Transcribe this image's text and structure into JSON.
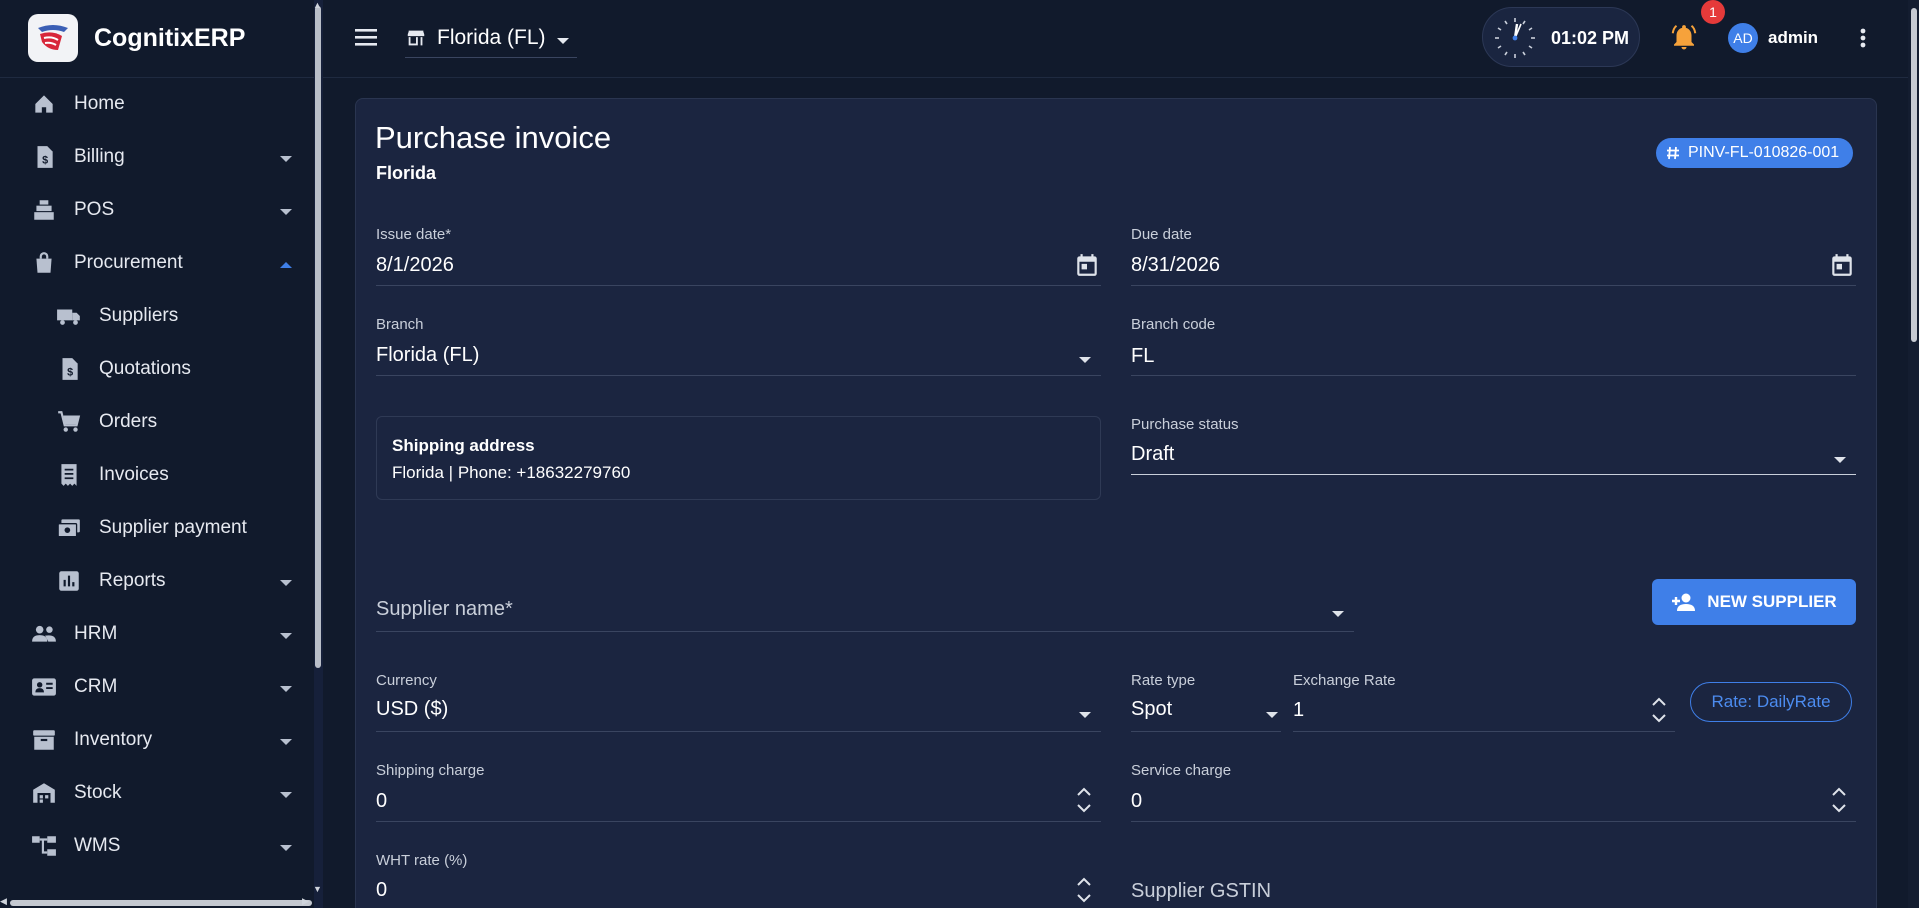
{
  "brand": {
    "name": "CognitixERP"
  },
  "sidebar": {
    "items": [
      {
        "label": "Home",
        "icon": "home-icon",
        "sub": false,
        "caret": ""
      },
      {
        "label": "Billing",
        "icon": "invoice-dollar-icon",
        "sub": false,
        "caret": "down"
      },
      {
        "label": "POS",
        "icon": "cash-register-icon",
        "sub": false,
        "caret": "down"
      },
      {
        "label": "Procurement",
        "icon": "shopping-bag-icon",
        "sub": false,
        "caret": "up"
      },
      {
        "label": "Suppliers",
        "icon": "truck-icon",
        "sub": true,
        "caret": ""
      },
      {
        "label": "Quotations",
        "icon": "request-quote-icon",
        "sub": true,
        "caret": ""
      },
      {
        "label": "Orders",
        "icon": "shopping-cart-icon",
        "sub": true,
        "caret": ""
      },
      {
        "label": "Invoices",
        "icon": "receipt-icon",
        "sub": true,
        "caret": ""
      },
      {
        "label": "Supplier payment",
        "icon": "payments-icon",
        "sub": true,
        "caret": ""
      },
      {
        "label": "Reports",
        "icon": "bar-chart-icon",
        "sub": true,
        "caret": "down"
      },
      {
        "label": "HRM",
        "icon": "people-icon",
        "sub": false,
        "caret": "down"
      },
      {
        "label": "CRM",
        "icon": "contact-card-icon",
        "sub": false,
        "caret": "down"
      },
      {
        "label": "Inventory",
        "icon": "archive-box-icon",
        "sub": false,
        "caret": "down"
      },
      {
        "label": "Stock",
        "icon": "warehouse-icon",
        "sub": false,
        "caret": "down"
      },
      {
        "label": "WMS",
        "icon": "account-tree-icon",
        "sub": false,
        "caret": "down"
      }
    ]
  },
  "header": {
    "branch": "Florida (FL)",
    "time": "01:02 PM",
    "notifications": "1",
    "avatar": "AD",
    "user": "admin"
  },
  "page": {
    "title": "Purchase invoice",
    "subtitle": "Florida",
    "invoice_number": "PINV-FL-010826-001"
  },
  "form": {
    "issue_date": {
      "label": "Issue date*",
      "value": "8/1/2026"
    },
    "due_date": {
      "label": "Due date",
      "value": "8/31/2026"
    },
    "branch": {
      "label": "Branch",
      "value": "Florida (FL)"
    },
    "branch_code": {
      "label": "Branch code",
      "value": "FL"
    },
    "shipping": {
      "title": "Shipping address",
      "text": "Florida | Phone: +18632279760"
    },
    "purchase_status": {
      "label": "Purchase status",
      "value": "Draft"
    },
    "supplier_name": {
      "label": "Supplier name*"
    },
    "new_supplier": "NEW SUPPLIER",
    "currency": {
      "label": "Currency",
      "value": "USD ($)"
    },
    "rate_type": {
      "label": "Rate type",
      "value": "Spot"
    },
    "exchange_rate": {
      "label": "Exchange Rate",
      "value": "1"
    },
    "rate_chip": "Rate: DailyRate",
    "shipping_charge": {
      "label": "Shipping charge",
      "value": "0"
    },
    "service_charge": {
      "label": "Service charge",
      "value": "0"
    },
    "wht_rate": {
      "label": "WHT rate (%)",
      "value": "0"
    },
    "supplier_gstin": {
      "label": "Supplier GSTIN"
    }
  },
  "colors": {
    "accent": "#3f7fe8",
    "background": "#111a2c",
    "card": "#1b2540",
    "bell": "#f6a23b",
    "badge": "#e53a3a"
  }
}
